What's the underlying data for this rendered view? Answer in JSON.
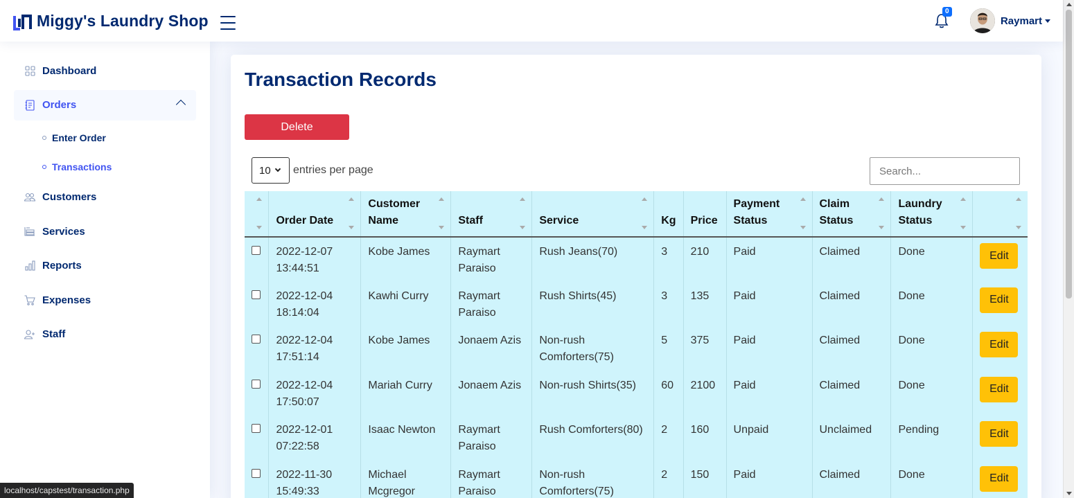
{
  "app": {
    "title": "Miggy's Laundry Shop",
    "notification_count": "0",
    "user_name": "Raymart"
  },
  "sidebar": {
    "items": [
      {
        "label": "Dashboard",
        "icon": "grid-icon"
      },
      {
        "label": "Orders",
        "icon": "journal-icon"
      },
      {
        "label": "Customers",
        "icon": "people-icon"
      },
      {
        "label": "Services",
        "icon": "list-icon"
      },
      {
        "label": "Reports",
        "icon": "bar-chart-icon"
      },
      {
        "label": "Expenses",
        "icon": "cart-icon"
      },
      {
        "label": "Staff",
        "icon": "person-plus-icon"
      }
    ],
    "orders_sub": [
      {
        "label": "Enter Order"
      },
      {
        "label": "Transactions"
      }
    ]
  },
  "main": {
    "title": "Transaction Records",
    "delete_label": "Delete",
    "entries_value": "10",
    "entries_label": "entries per page",
    "search_placeholder": "Search..."
  },
  "table": {
    "headers": [
      "",
      "Order Date",
      "Customer Name",
      "Staff",
      "Service",
      "Kg",
      "Price",
      "Payment Status",
      "Claim Status",
      "Laundry Status",
      ""
    ],
    "edit_label": "Edit",
    "rows": [
      {
        "date": "2022-12-07 13:44:51",
        "customer": "Kobe James",
        "staff": "Raymart Paraiso",
        "service": "Rush Jeans(70)",
        "kg": "3",
        "price": "210",
        "payment": "Paid",
        "claim": "Claimed",
        "laundry": "Done"
      },
      {
        "date": "2022-12-04 18:14:04",
        "customer": "Kawhi Curry",
        "staff": "Raymart Paraiso",
        "service": "Rush Shirts(45)",
        "kg": "3",
        "price": "135",
        "payment": "Paid",
        "claim": "Claimed",
        "laundry": "Done"
      },
      {
        "date": "2022-12-04 17:51:14",
        "customer": "Kobe James",
        "staff": "Jonaem Azis",
        "service": "Non-rush Comforters(75)",
        "kg": "5",
        "price": "375",
        "payment": "Paid",
        "claim": "Claimed",
        "laundry": "Done"
      },
      {
        "date": "2022-12-04 17:50:07",
        "customer": "Mariah Curry",
        "staff": "Jonaem Azis",
        "service": "Non-rush Shirts(35)",
        "kg": "60",
        "price": "2100",
        "payment": "Paid",
        "claim": "Claimed",
        "laundry": "Done"
      },
      {
        "date": "2022-12-01 07:22:58",
        "customer": "Isaac Newton",
        "staff": "Raymart Paraiso",
        "service": "Rush Comforters(80)",
        "kg": "2",
        "price": "160",
        "payment": "Unpaid",
        "claim": "Unclaimed",
        "laundry": "Pending"
      },
      {
        "date": "2022-11-30 15:49:33",
        "customer": "Michael Mcgregor",
        "staff": "Raymart Paraiso",
        "service": "Non-rush Comforters(75)",
        "kg": "2",
        "price": "150",
        "payment": "Paid",
        "claim": "Claimed",
        "laundry": "Done"
      }
    ]
  },
  "statusbar": {
    "url": "localhost/capstest/transaction.php"
  },
  "colors": {
    "brand": "#012970",
    "accent": "#4154f1",
    "delete": "#dc3545",
    "edit": "#ffc107",
    "table_bg": "#cff4fc"
  }
}
